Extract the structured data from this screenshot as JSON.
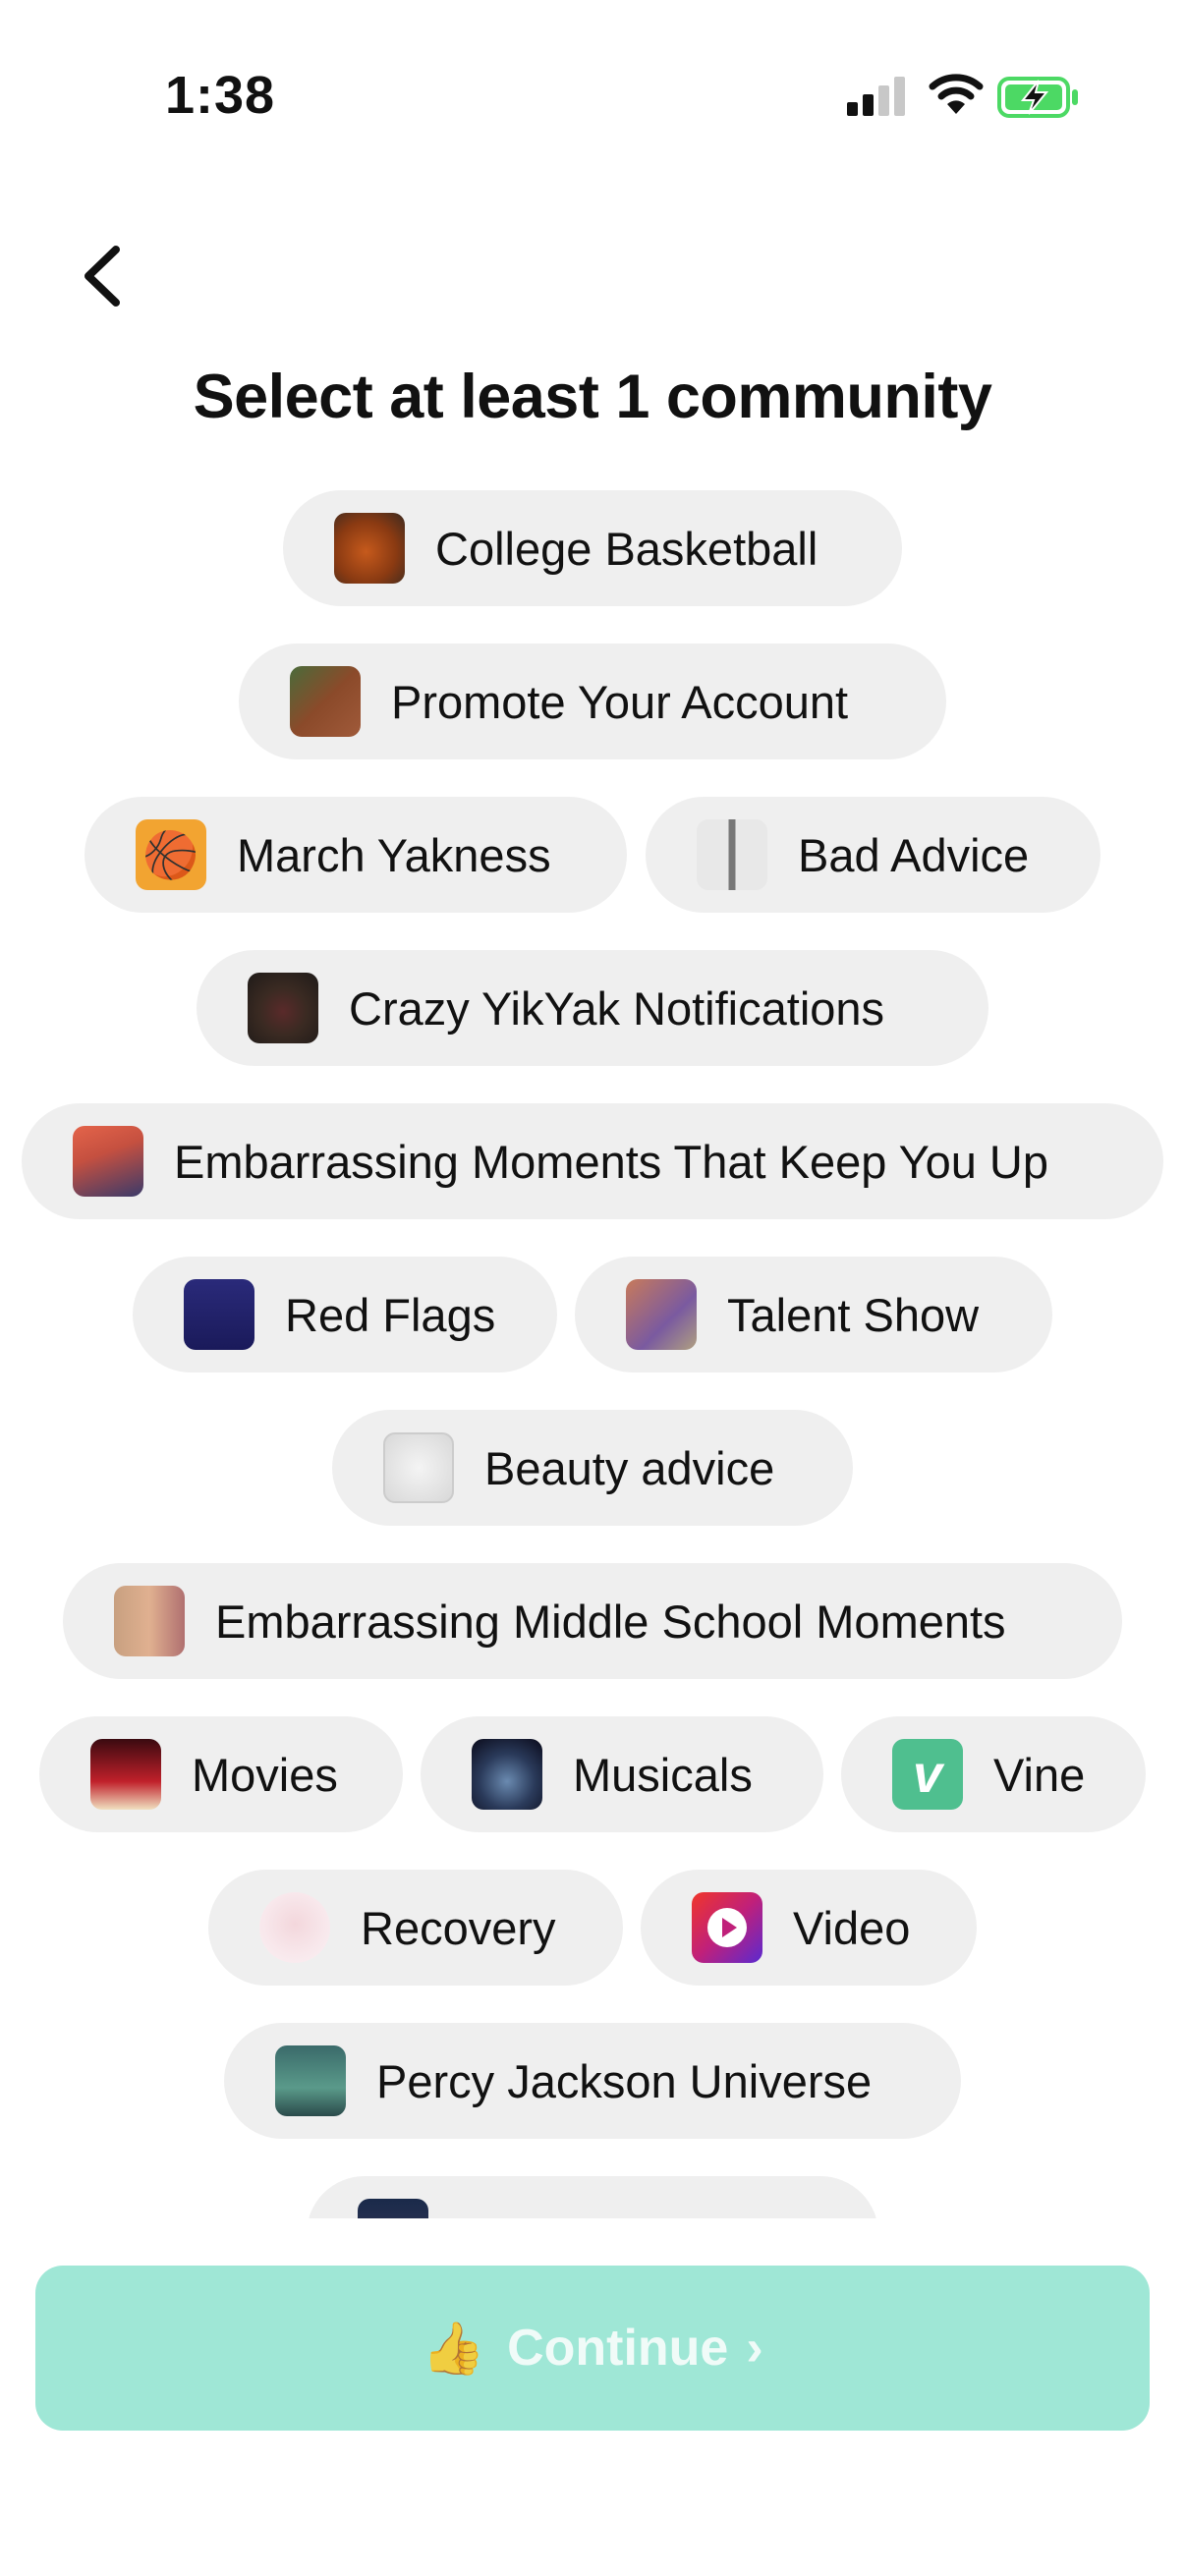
{
  "status": {
    "time": "1:38"
  },
  "page": {
    "title": "Select at least 1 community"
  },
  "icons": {
    "back": "chevron-left-icon",
    "signal": "cellular-signal-icon",
    "wifi": "wifi-icon",
    "battery": "battery-charging-icon",
    "continue": "thumbs-up-icon"
  },
  "communities": [
    {
      "label": "College Basketball"
    },
    {
      "label": "Promote Your Account"
    },
    {
      "label": "March Yakness"
    },
    {
      "label": "Bad Advice"
    },
    {
      "label": "Crazy YikYak Notifications"
    },
    {
      "label": "Embarrassing Moments That Keep You Up"
    },
    {
      "label": "Red Flags"
    },
    {
      "label": "Talent Show"
    },
    {
      "label": "Beauty advice"
    },
    {
      "label": "Embarrassing Middle School Moments"
    },
    {
      "label": "Movies"
    },
    {
      "label": "Musicals"
    },
    {
      "label": "Vine"
    },
    {
      "label": "Recovery"
    },
    {
      "label": "Video"
    },
    {
      "label": "Percy Jackson Universe"
    },
    {
      "label": ""
    }
  ],
  "continue_button": {
    "label": "Continue",
    "emoji": "👍",
    "chevron": "›"
  },
  "colors": {
    "chip_bg": "#efefef",
    "continue_bg": "#9fe7d6",
    "battery_green": "#4cd964"
  }
}
